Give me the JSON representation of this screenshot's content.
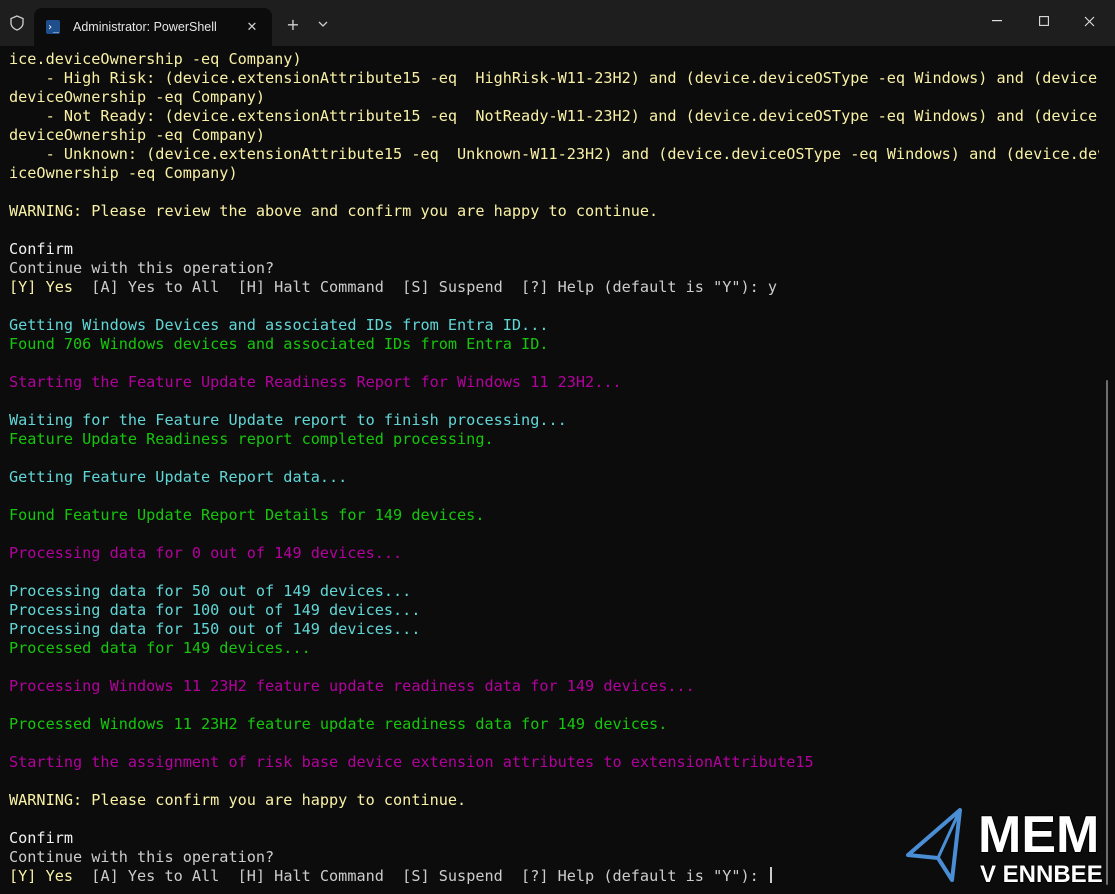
{
  "window": {
    "tab_title": "Administrator: PowerShell",
    "icons": {
      "shield": "shield-icon",
      "powershell": "powershell-icon",
      "close_tab": "close-icon",
      "new_tab": "plus-icon",
      "dropdown": "chevron-down-icon",
      "minimize": "minimize-icon",
      "maximize": "maximize-icon",
      "close_window": "close-icon"
    }
  },
  "colors": {
    "background": "#0c0c0c",
    "yellow": "#f9f1a5",
    "cyan": "#61d6d6",
    "green": "#16c60c",
    "magenta": "#b4009e",
    "default": "#cccccc"
  },
  "terminal": {
    "lines": [
      {
        "text": "ice.deviceOwnership -eq Company)",
        "color": "yellow"
      },
      {
        "text": "    - High Risk: (device.extensionAttribute15 -eq  HighRisk-W11-23H2) and (device.deviceOSType -eq Windows) and (device.",
        "color": "yellow"
      },
      {
        "text": "deviceOwnership -eq Company)",
        "color": "yellow"
      },
      {
        "text": "    - Not Ready: (device.extensionAttribute15 -eq  NotReady-W11-23H2) and (device.deviceOSType -eq Windows) and (device.",
        "color": "yellow"
      },
      {
        "text": "deviceOwnership -eq Company)",
        "color": "yellow"
      },
      {
        "text": "    - Unknown: (device.extensionAttribute15 -eq  Unknown-W11-23H2) and (device.deviceOSType -eq Windows) and (device.dev",
        "color": "yellow"
      },
      {
        "text": "iceOwnership -eq Company)",
        "color": "yellow"
      },
      {
        "text": "",
        "color": "default"
      },
      {
        "text": "WARNING: Please review the above and confirm you are happy to continue.",
        "color": "yellow"
      },
      {
        "text": "",
        "color": "default"
      },
      {
        "text": "Confirm",
        "color": "bold"
      },
      {
        "text": "Continue with this operation?",
        "color": "default"
      },
      {
        "text": "",
        "color": "prompt",
        "prompt": {
          "yes": "[Y] Yes",
          "rest": "  [A] Yes to All  [H] Halt Command  [S] Suspend  [?] Help (default is \"Y\"): y"
        }
      },
      {
        "text": "",
        "color": "default"
      },
      {
        "text": "Getting Windows Devices and associated IDs from Entra ID...",
        "color": "cyan"
      },
      {
        "text": "Found 706 Windows devices and associated IDs from Entra ID.",
        "color": "green"
      },
      {
        "text": "",
        "color": "default"
      },
      {
        "text": "Starting the Feature Update Readiness Report for Windows 11 23H2...",
        "color": "magenta"
      },
      {
        "text": "",
        "color": "default"
      },
      {
        "text": "Waiting for the Feature Update report to finish processing...",
        "color": "cyan"
      },
      {
        "text": "Feature Update Readiness report completed processing.",
        "color": "green"
      },
      {
        "text": "",
        "color": "default"
      },
      {
        "text": "Getting Feature Update Report data...",
        "color": "cyan"
      },
      {
        "text": "",
        "color": "default"
      },
      {
        "text": "Found Feature Update Report Details for 149 devices.",
        "color": "green"
      },
      {
        "text": "",
        "color": "default"
      },
      {
        "text": "Processing data for 0 out of 149 devices...",
        "color": "magenta"
      },
      {
        "text": "",
        "color": "default"
      },
      {
        "text": "Processing data for 50 out of 149 devices...",
        "color": "cyan"
      },
      {
        "text": "Processing data for 100 out of 149 devices...",
        "color": "cyan"
      },
      {
        "text": "Processing data for 150 out of 149 devices...",
        "color": "cyan"
      },
      {
        "text": "Processed data for 149 devices...",
        "color": "green"
      },
      {
        "text": "",
        "color": "default"
      },
      {
        "text": "Processing Windows 11 23H2 feature update readiness data for 149 devices...",
        "color": "magenta"
      },
      {
        "text": "",
        "color": "default"
      },
      {
        "text": "Processed Windows 11 23H2 feature update readiness data for 149 devices.",
        "color": "green"
      },
      {
        "text": "",
        "color": "default"
      },
      {
        "text": "Starting the assignment of risk base device extension attributes to extensionAttribute15",
        "color": "magenta"
      },
      {
        "text": "",
        "color": "default"
      },
      {
        "text": "WARNING: Please confirm you are happy to continue.",
        "color": "yellow"
      },
      {
        "text": "",
        "color": "default"
      },
      {
        "text": "Confirm",
        "color": "bold"
      },
      {
        "text": "Continue with this operation?",
        "color": "default"
      },
      {
        "text": "",
        "color": "prompt",
        "cursor": true,
        "prompt": {
          "yes": "[Y] Yes",
          "rest": "  [A] Yes to All  [H] Halt Command  [S] Suspend  [?] Help (default is \"Y\"): "
        }
      }
    ]
  },
  "logo": {
    "line1": "MEM",
    "line2": "V ENNBEE"
  }
}
